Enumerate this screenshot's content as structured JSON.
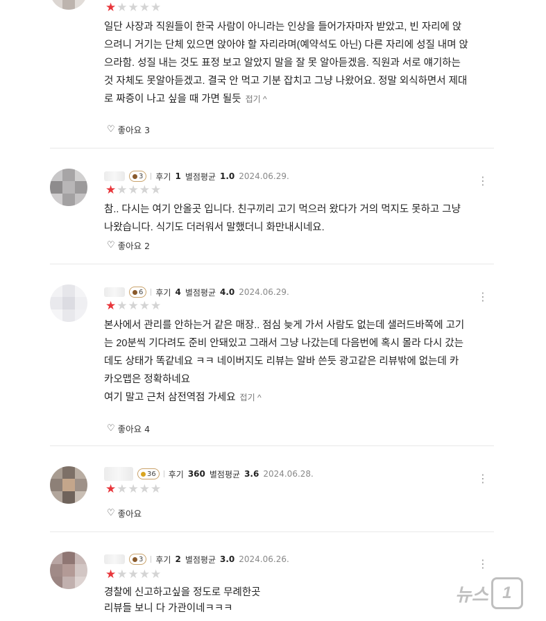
{
  "reviews": [
    {
      "rating": 1,
      "lines": [
        "일단 사장과 직원들이 한국 사람이 아니라는 인상을 들어가자마자 받았고, 빈 자리에 앉",
        "으려니 거기는 단체 있으면 앉아야 할 자리라며(예약석도 아닌) 다른 자리에 성질 내며 앉",
        "으라함. 성질 내는 것도 표정 보고 알았지 말을 잘 못 알아듣겠음. 직원과 서로 얘기하는",
        "것 자체도 못알아듣겠고. 결국 안 먹고 기분 잡치고 그냥 나왔어요. 정말 외식하면서 제대",
        "로 짜증이 나고 싶을 때 가면 될듯"
      ],
      "fold_label": "접기 ^",
      "like_label": "좋아요 3"
    },
    {
      "badge": "3",
      "review_label": "후기",
      "review_count": "1",
      "avg_label": "별점평균",
      "avg": "1.0",
      "date": "2024.06.29.",
      "rating": 1,
      "lines": [
        "참.. 다시는 여기 안올곳 입니다. 친구끼리 고기 먹으러 왔다가 거의 먹지도 못하고 그냥",
        "나왔습니다. 식기도 더러워서 말했더니 화만내시네요."
      ],
      "like_label": "좋아요 2"
    },
    {
      "badge": "6",
      "review_label": "후기",
      "review_count": "4",
      "avg_label": "별점평균",
      "avg": "4.0",
      "date": "2024.06.29.",
      "rating": 1,
      "lines": [
        "본사에서 관리를 안하는거 같은 매장.. 점심 늦게 가서 사람도 없는데 샐러드바쪽에 고기",
        "는 20분씩 기다려도 준비 안돼있고 그래서 그냥 나갔는데 다음번에 혹시 몰라 다시 갔는",
        "데도 상태가 똑같네요 ㅋㅋ 네이버지도 리뷰는 알바 쓴듯 광고같은 리뷰밖에 없는데 카",
        "카오맵은 정확하네요",
        "여기 말고 근처 삼전역점 가세요"
      ],
      "fold_label": "접기 ^",
      "like_label": "좋아요 4"
    },
    {
      "badge": "36",
      "review_label": "후기",
      "review_count": "360",
      "avg_label": "별점평균",
      "avg": "3.6",
      "date": "2024.06.28.",
      "rating": 1,
      "lines": [],
      "like_label": "좋아요"
    },
    {
      "badge": "3",
      "review_label": "후기",
      "review_count": "2",
      "avg_label": "별점평균",
      "avg": "3.0",
      "date": "2024.06.26.",
      "rating": 1,
      "lines": [
        "경찰에 신고하고싶을 정도로 무례한곳",
        "리뷰들 보니 다 가관이네ㅋㅋㅋ"
      ]
    }
  ],
  "more_icon": "⋮",
  "watermark": {
    "text": "뉴스",
    "badge": "1"
  },
  "colors": {
    "star_on": "#e8363b",
    "star_off": "#d4d4d4",
    "divider": "#e8e8e8"
  }
}
